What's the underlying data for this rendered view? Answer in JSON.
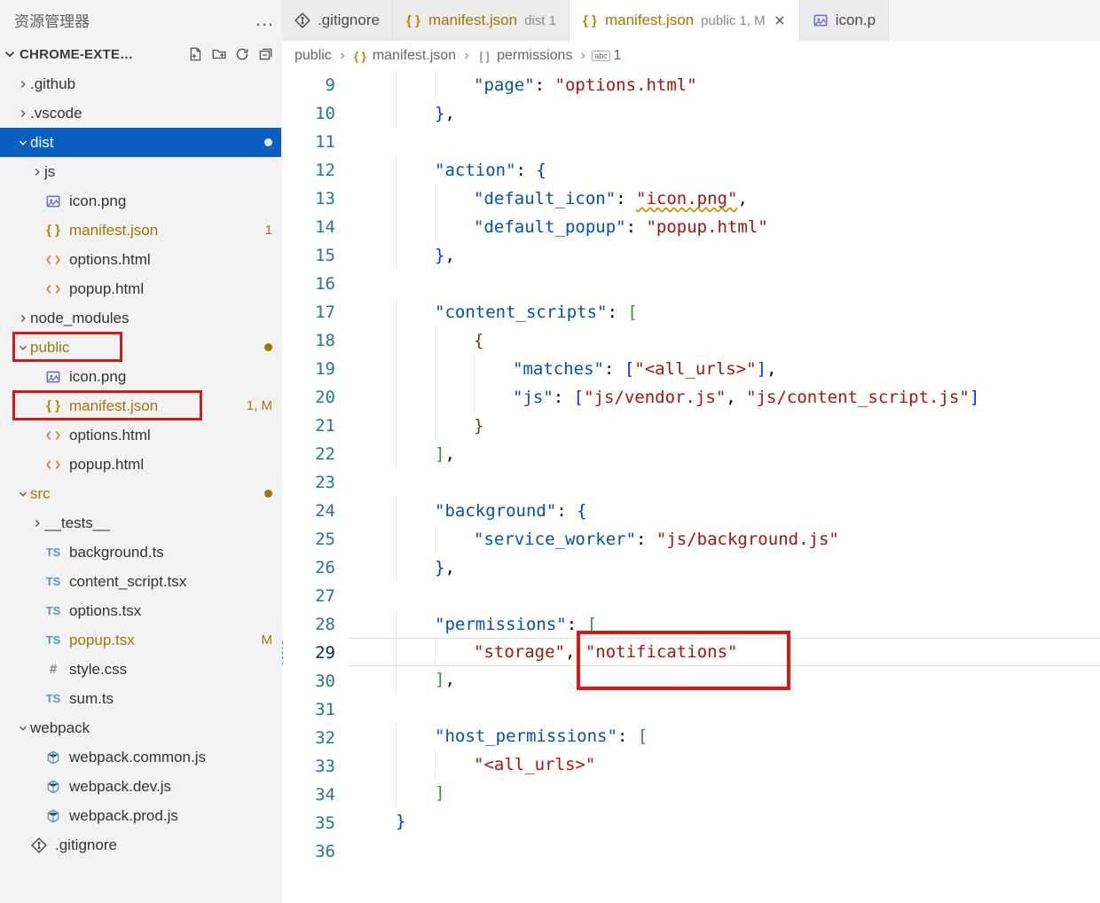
{
  "sidebar": {
    "title": "资源管理器",
    "project": "CHROME-EXTE…",
    "actions": [
      "new-file",
      "new-folder",
      "refresh",
      "collapse-all"
    ],
    "tree": [
      {
        "k": "github",
        "name": ".github",
        "type": "folder",
        "state": "collapsed",
        "depth": 0
      },
      {
        "k": "vscode",
        "name": ".vscode",
        "type": "folder",
        "state": "collapsed",
        "depth": 0
      },
      {
        "k": "dist",
        "name": "dist",
        "type": "folder",
        "state": "expanded",
        "depth": 0,
        "selected": true,
        "dirtyWhite": true
      },
      {
        "k": "dist_js",
        "name": "js",
        "type": "folder",
        "state": "collapsed",
        "depth": 1
      },
      {
        "k": "dist_icon",
        "name": "icon.png",
        "type": "image",
        "depth": 1
      },
      {
        "k": "dist_manifest",
        "name": "manifest.json",
        "type": "json",
        "depth": 1,
        "modified": true,
        "badge": "1"
      },
      {
        "k": "dist_options",
        "name": "options.html",
        "type": "html",
        "depth": 1
      },
      {
        "k": "dist_popup",
        "name": "popup.html",
        "type": "html",
        "depth": 1
      },
      {
        "k": "node_modules",
        "name": "node_modules",
        "type": "folder",
        "state": "collapsed",
        "depth": 0
      },
      {
        "k": "public",
        "name": "public",
        "type": "folder",
        "state": "expanded",
        "depth": 0,
        "modified": true,
        "dirty": true
      },
      {
        "k": "public_icon",
        "name": "icon.png",
        "type": "image",
        "depth": 1
      },
      {
        "k": "public_manifest",
        "name": "manifest.json",
        "type": "json",
        "depth": 1,
        "modified": true,
        "badge": "1, M"
      },
      {
        "k": "public_options",
        "name": "options.html",
        "type": "html",
        "depth": 1
      },
      {
        "k": "public_popup",
        "name": "popup.html",
        "type": "html",
        "depth": 1
      },
      {
        "k": "src",
        "name": "src",
        "type": "folder",
        "state": "expanded",
        "depth": 0,
        "modified": true,
        "dirty": true
      },
      {
        "k": "src_tests",
        "name": "__tests__",
        "type": "folder",
        "state": "collapsed",
        "depth": 1
      },
      {
        "k": "src_bg",
        "name": "background.ts",
        "type": "ts",
        "depth": 1
      },
      {
        "k": "src_cs",
        "name": "content_script.tsx",
        "type": "ts",
        "depth": 1
      },
      {
        "k": "src_opt",
        "name": "options.tsx",
        "type": "ts",
        "depth": 1
      },
      {
        "k": "src_popup",
        "name": "popup.tsx",
        "type": "ts",
        "depth": 1,
        "modified": true,
        "badge": "M"
      },
      {
        "k": "src_style",
        "name": "style.css",
        "type": "css",
        "depth": 1
      },
      {
        "k": "src_sum",
        "name": "sum.ts",
        "type": "ts",
        "depth": 1
      },
      {
        "k": "webpack",
        "name": "webpack",
        "type": "folder",
        "state": "expanded",
        "depth": 0
      },
      {
        "k": "wp_common",
        "name": "webpack.common.js",
        "type": "webpack",
        "depth": 1
      },
      {
        "k": "wp_dev",
        "name": "webpack.dev.js",
        "type": "webpack",
        "depth": 1
      },
      {
        "k": "wp_prod",
        "name": "webpack.prod.js",
        "type": "webpack",
        "depth": 1
      },
      {
        "k": "gitignore",
        "name": ".gitignore",
        "type": "git",
        "depth": 0
      }
    ]
  },
  "tabs": [
    {
      "k": "t_gitignore",
      "icon": "git",
      "label": ".gitignore",
      "suffix": "",
      "active": false,
      "modified": false,
      "close": false
    },
    {
      "k": "t_manifest_dist",
      "icon": "json",
      "label": "manifest.json",
      "suffix": "dist 1",
      "active": false,
      "modified": true,
      "close": false
    },
    {
      "k": "t_manifest_public",
      "icon": "json",
      "label": "manifest.json",
      "suffix": "public 1, M",
      "active": true,
      "modified": true,
      "close": true
    },
    {
      "k": "t_iconp",
      "icon": "image",
      "label": "icon.p",
      "suffix": "",
      "active": false,
      "modified": false,
      "close": false
    }
  ],
  "breadcrumbs": {
    "parts": [
      {
        "label": "public",
        "icon": null
      },
      {
        "label": "manifest.json",
        "icon": "json"
      },
      {
        "label": "permissions",
        "icon": "array"
      },
      {
        "label": "1",
        "icon": "abc"
      }
    ]
  },
  "editor": {
    "first_line": 9,
    "current_line": 29,
    "lines": [
      {
        "n": 9,
        "seg": [
          {
            "ig": 3
          },
          {
            "t": "\"page\"",
            "c": "prop"
          },
          {
            "t": ": ",
            "c": "punct"
          },
          {
            "t": "\"options.html\"",
            "c": "str"
          }
        ]
      },
      {
        "n": 10,
        "seg": [
          {
            "ig": 2
          },
          {
            "t": "}",
            "c": "brace"
          },
          {
            "t": ",",
            "c": "punct"
          }
        ]
      },
      {
        "n": 11,
        "seg": [
          {
            "ig": 1
          }
        ]
      },
      {
        "n": 12,
        "seg": [
          {
            "ig": 2
          },
          {
            "t": "\"action\"",
            "c": "prop"
          },
          {
            "t": ": ",
            "c": "punct"
          },
          {
            "t": "{",
            "c": "brace"
          }
        ]
      },
      {
        "n": 13,
        "seg": [
          {
            "ig": 3
          },
          {
            "t": "\"default_icon\"",
            "c": "prop"
          },
          {
            "t": ": ",
            "c": "punct"
          },
          {
            "t": "\"icon.png\"",
            "c": "str",
            "squig": true
          },
          {
            "t": ",",
            "c": "punct"
          }
        ]
      },
      {
        "n": 14,
        "seg": [
          {
            "ig": 3
          },
          {
            "t": "\"default_popup\"",
            "c": "prop"
          },
          {
            "t": ": ",
            "c": "punct"
          },
          {
            "t": "\"popup.html\"",
            "c": "str"
          }
        ]
      },
      {
        "n": 15,
        "seg": [
          {
            "ig": 2
          },
          {
            "t": "}",
            "c": "brace"
          },
          {
            "t": ",",
            "c": "punct"
          }
        ]
      },
      {
        "n": 16,
        "seg": [
          {
            "ig": 1
          }
        ]
      },
      {
        "n": 17,
        "seg": [
          {
            "ig": 2
          },
          {
            "t": "\"content_scripts\"",
            "c": "prop"
          },
          {
            "t": ": ",
            "c": "punct"
          },
          {
            "t": "[",
            "c": "brk"
          }
        ]
      },
      {
        "n": 18,
        "seg": [
          {
            "ig": 3
          },
          {
            "t": "{",
            "c": "par"
          }
        ]
      },
      {
        "n": 19,
        "seg": [
          {
            "ig": 4
          },
          {
            "t": "\"matches\"",
            "c": "prop"
          },
          {
            "t": ": ",
            "c": "punct"
          },
          {
            "t": "[",
            "c": "brace"
          },
          {
            "t": "\"<all_urls>\"",
            "c": "str"
          },
          {
            "t": "]",
            "c": "brace"
          },
          {
            "t": ",",
            "c": "punct"
          }
        ]
      },
      {
        "n": 20,
        "seg": [
          {
            "ig": 4
          },
          {
            "t": "\"js\"",
            "c": "prop"
          },
          {
            "t": ": ",
            "c": "punct"
          },
          {
            "t": "[",
            "c": "brace"
          },
          {
            "t": "\"js/vendor.js\"",
            "c": "str"
          },
          {
            "t": ", ",
            "c": "punct"
          },
          {
            "t": "\"js/content_script.js\"",
            "c": "str"
          },
          {
            "t": "]",
            "c": "brace"
          }
        ]
      },
      {
        "n": 21,
        "seg": [
          {
            "ig": 3
          },
          {
            "t": "}",
            "c": "par"
          }
        ]
      },
      {
        "n": 22,
        "seg": [
          {
            "ig": 2
          },
          {
            "t": "]",
            "c": "brk"
          },
          {
            "t": ",",
            "c": "punct"
          }
        ]
      },
      {
        "n": 23,
        "seg": [
          {
            "ig": 1
          }
        ]
      },
      {
        "n": 24,
        "seg": [
          {
            "ig": 2
          },
          {
            "t": "\"background\"",
            "c": "prop"
          },
          {
            "t": ": ",
            "c": "punct"
          },
          {
            "t": "{",
            "c": "brace"
          }
        ]
      },
      {
        "n": 25,
        "seg": [
          {
            "ig": 3
          },
          {
            "t": "\"service_worker\"",
            "c": "prop"
          },
          {
            "t": ": ",
            "c": "punct"
          },
          {
            "t": "\"js/background.js\"",
            "c": "str"
          }
        ]
      },
      {
        "n": 26,
        "seg": [
          {
            "ig": 2
          },
          {
            "t": "}",
            "c": "brace"
          },
          {
            "t": ",",
            "c": "punct"
          }
        ]
      },
      {
        "n": 27,
        "seg": [
          {
            "ig": 1
          }
        ]
      },
      {
        "n": 28,
        "seg": [
          {
            "ig": 2
          },
          {
            "t": "\"permissions\"",
            "c": "prop"
          },
          {
            "t": ": ",
            "c": "punct"
          },
          {
            "t": "[",
            "c": "brk"
          }
        ]
      },
      {
        "n": 29,
        "cur": true,
        "seg": [
          {
            "ig": 3
          },
          {
            "t": "\"storage\"",
            "c": "str"
          },
          {
            "t": ",",
            "c": "punct"
          },
          {
            "t": " ",
            "c": "punct"
          },
          {
            "t": "\"notifications\"",
            "c": "str"
          }
        ]
      },
      {
        "n": 30,
        "seg": [
          {
            "ig": 2
          },
          {
            "t": "]",
            "c": "brk"
          },
          {
            "t": ",",
            "c": "punct"
          }
        ]
      },
      {
        "n": 31,
        "seg": [
          {
            "ig": 1
          }
        ]
      },
      {
        "n": 32,
        "seg": [
          {
            "ig": 2
          },
          {
            "t": "\"host_permissions\"",
            "c": "prop"
          },
          {
            "t": ": ",
            "c": "punct"
          },
          {
            "t": "[",
            "c": "brk"
          }
        ]
      },
      {
        "n": 33,
        "seg": [
          {
            "ig": 3
          },
          {
            "t": "\"<all_urls>\"",
            "c": "str"
          }
        ]
      },
      {
        "n": 34,
        "seg": [
          {
            "ig": 2
          },
          {
            "t": "]",
            "c": "brk"
          }
        ]
      },
      {
        "n": 35,
        "seg": [
          {
            "ig": 1
          },
          {
            "t": "}",
            "c": "brace"
          }
        ]
      },
      {
        "n": 36,
        "seg": []
      }
    ]
  },
  "annotations": {
    "sidebar_boxes": [
      "public_folder",
      "public_manifest"
    ],
    "editor_box": {
      "token": "notifications",
      "line": 29
    }
  }
}
